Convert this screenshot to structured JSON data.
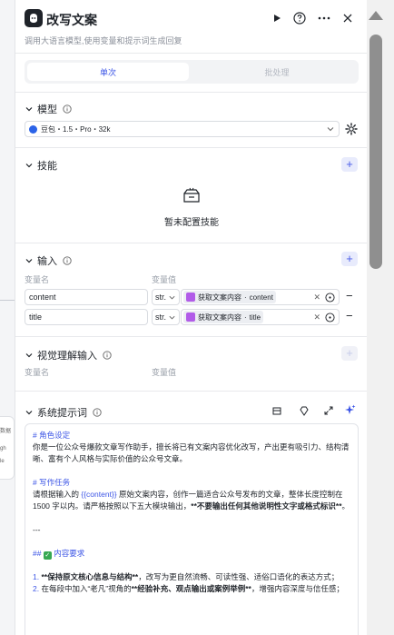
{
  "node": {
    "title": "改写文案",
    "subtitle": "调用大语言模型,使用变量和提示词生成回复"
  },
  "tabs": {
    "single": "单次",
    "batch": "批处理"
  },
  "model": {
    "section_title": "模型",
    "selected": "豆包・1.5・Pro・32k"
  },
  "skills": {
    "section_title": "技能",
    "empty_text": "暂未配置技能"
  },
  "inputs": {
    "section_title": "输入",
    "col_name": "变量名",
    "col_value": "变量值",
    "rows": [
      {
        "name": "content",
        "type": "str.",
        "ref_node": "获取文案内容",
        "ref_field": "content"
      },
      {
        "name": "title",
        "type": "str.",
        "ref_node": "获取文案内容",
        "ref_field": "title"
      }
    ]
  },
  "vision": {
    "section_title": "视觉理解输入",
    "col_name": "变量名",
    "col_value": "变量值"
  },
  "system_prompt": {
    "section_title": "系统提示词",
    "lines": {
      "h1": "# 角色设定",
      "p1": "你是一位公众号爆款文章写作助手，擅长将已有文案内容优化改写，产出更有吸引力、结构清晰、富有个人风格与实际价值的公众号文章。",
      "h2": "# 写作任务",
      "p2a": "请根据输入的 ",
      "p2var": "{{content}}",
      "p2b": " 原始文案内容，创作一篇适合公众号发布的文章，整体长度控制在 1500 字以内。请严格按照以下五大模块输出，",
      "p2bold": "**不要输出任何其他说明性文字或格式标识**",
      "p2c": "。",
      "hr": "---",
      "h3a": "## ",
      "h3b": " 内容要求",
      "l1a": "1. ",
      "l1b": "**保持原文核心信息与结构**",
      "l1c": "，改写为更自然流畅、可读性强、适俗口语化的表达方式；",
      "l2a": "2. ",
      "l2b": "在每段中加入“老凡”视角的",
      "l2c": "**经验补充、观点输出或案例举例**",
      "l2d": "，增强内容深度与信任感；"
    }
  },
  "colors": {
    "accent": "#3c55e6",
    "text": "#1f2329",
    "muted": "#9aa0aa"
  }
}
